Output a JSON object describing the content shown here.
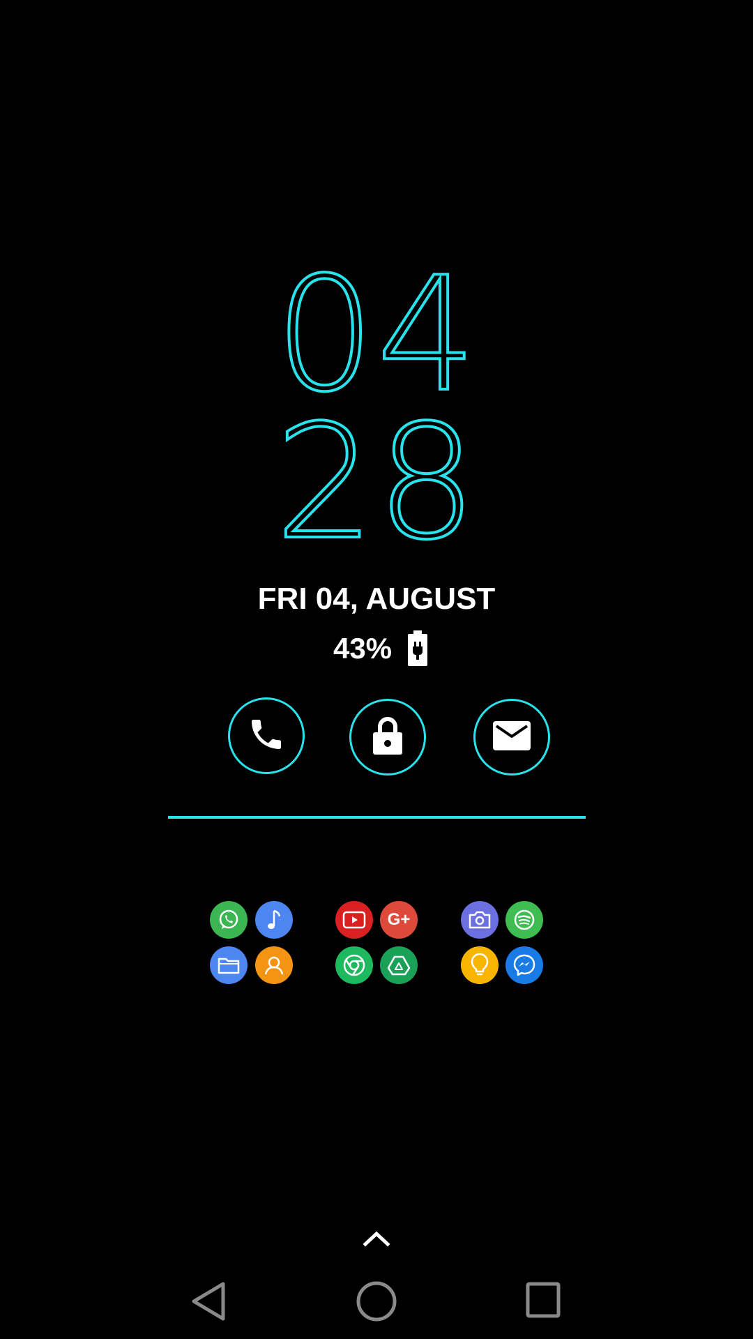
{
  "clock": {
    "hours": "04",
    "minutes": "28"
  },
  "date": "FRI 04, AUGUST",
  "battery": {
    "percent_text": "43%",
    "icon": "battery-charging-icon"
  },
  "quick_actions": [
    {
      "name": "phone",
      "icon": "phone-icon"
    },
    {
      "name": "lock",
      "icon": "lock-icon"
    },
    {
      "name": "mail",
      "icon": "mail-icon"
    }
  ],
  "app_shortcuts": [
    {
      "name": "whatsapp",
      "icon": "whatsapp-icon",
      "color": "#3cb653"
    },
    {
      "name": "music",
      "icon": "music-note-icon",
      "color": "#4d86f0"
    },
    {
      "name": "youtube",
      "icon": "youtube-icon",
      "color": "#d92121"
    },
    {
      "name": "google-plus",
      "icon": "google-plus-icon",
      "color": "#de4a3a",
      "label": "G+"
    },
    {
      "name": "camera",
      "icon": "camera-icon",
      "color": "#6c6fe0"
    },
    {
      "name": "spotify",
      "icon": "spotify-icon",
      "color": "#3fbd52"
    },
    {
      "name": "files",
      "icon": "folder-icon",
      "color": "#4d86f0"
    },
    {
      "name": "contacts",
      "icon": "contact-icon",
      "color": "#f39412"
    },
    {
      "name": "chrome",
      "icon": "chrome-icon",
      "color": "#1eb85e"
    },
    {
      "name": "drive",
      "icon": "drive-icon",
      "color": "#1ba058"
    },
    {
      "name": "tips",
      "icon": "lightbulb-icon",
      "color": "#f7b500"
    },
    {
      "name": "messenger",
      "icon": "messenger-icon",
      "color": "#1a7ae6"
    }
  ],
  "colors": {
    "accent": "#29e3ec",
    "background": "#000000",
    "text": "#ffffff",
    "nav": "#8a8a8a"
  },
  "navigation": {
    "swipe_up": "chevron-up-icon",
    "back": "back-triangle-icon",
    "home": "home-circle-icon",
    "recent": "recent-square-icon"
  }
}
